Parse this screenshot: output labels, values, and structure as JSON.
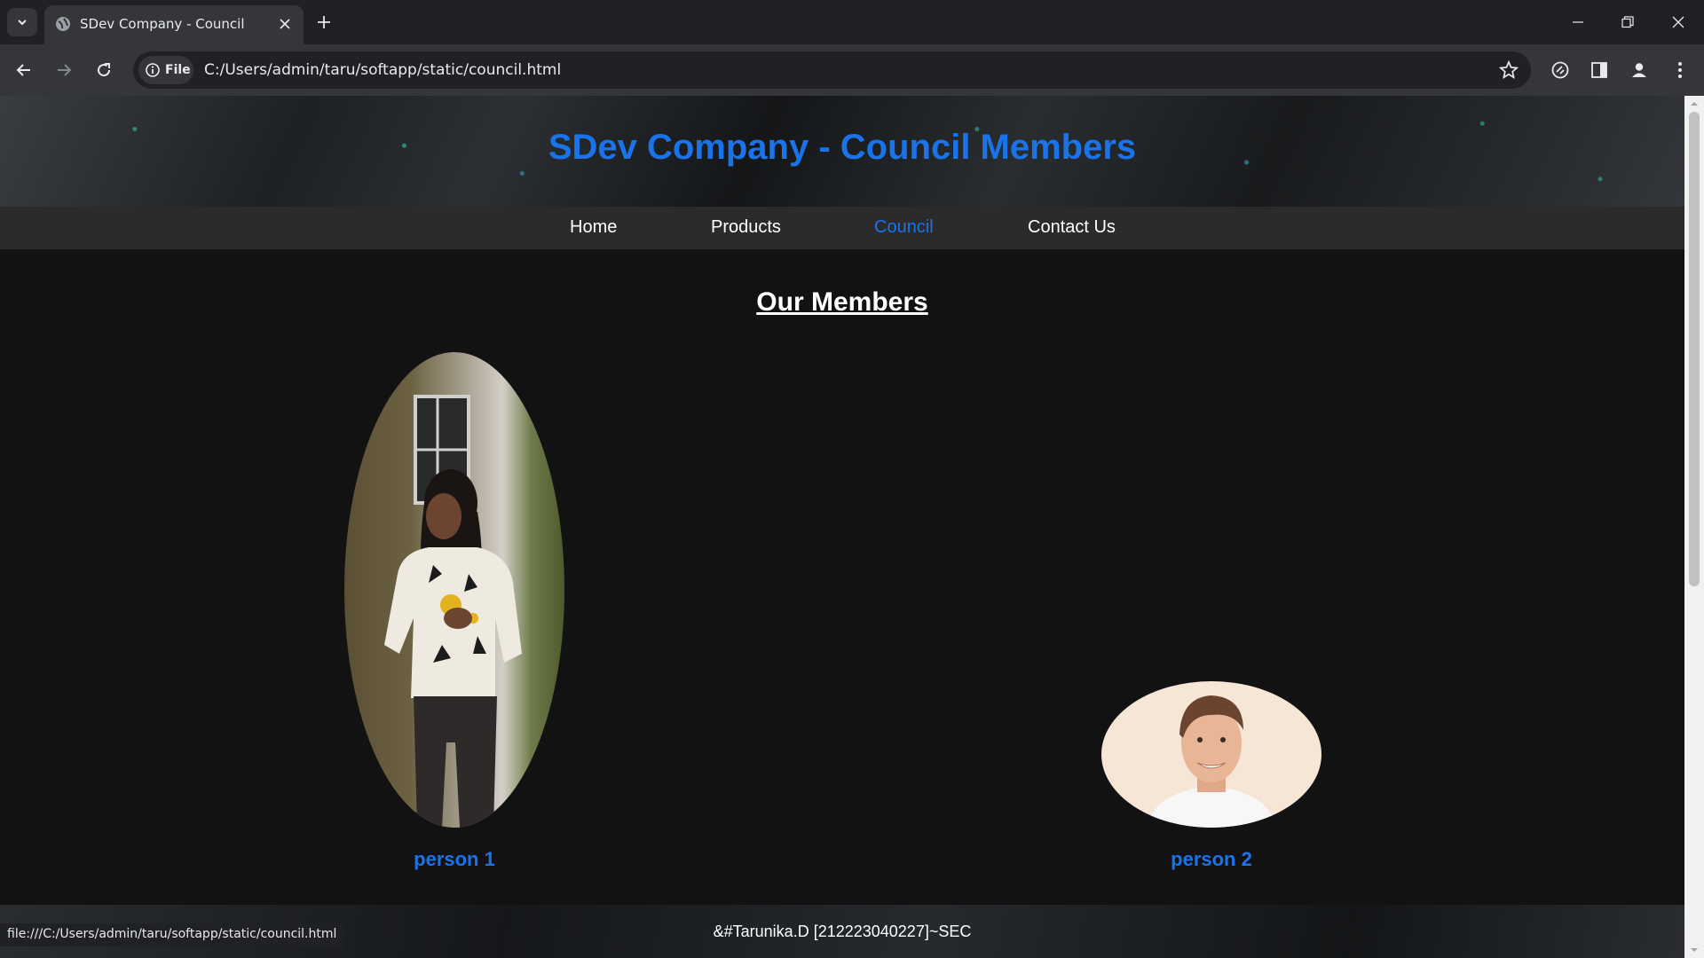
{
  "browser": {
    "tab_title": "SDev Company - Council",
    "file_chip_label": "File",
    "url": "C:/Users/admin/taru/softapp/static/council.html",
    "status_url": "file:///C:/Users/admin/taru/softapp/static/council.html"
  },
  "page": {
    "hero_title": "SDev Company - Council Members",
    "nav": [
      {
        "label": "Home",
        "active": false
      },
      {
        "label": "Products",
        "active": false
      },
      {
        "label": "Council",
        "active": true
      },
      {
        "label": "Contact Us",
        "active": false
      }
    ],
    "section_title": "Our Members",
    "members": [
      {
        "name": "person 1"
      },
      {
        "name": "person 2"
      }
    ],
    "footer": "&#Tarunika.D [212223040227]~SEC"
  },
  "colors": {
    "accent": "#1a73e8",
    "page_bg": "#121212",
    "nav_bg": "#2b2b2b"
  }
}
